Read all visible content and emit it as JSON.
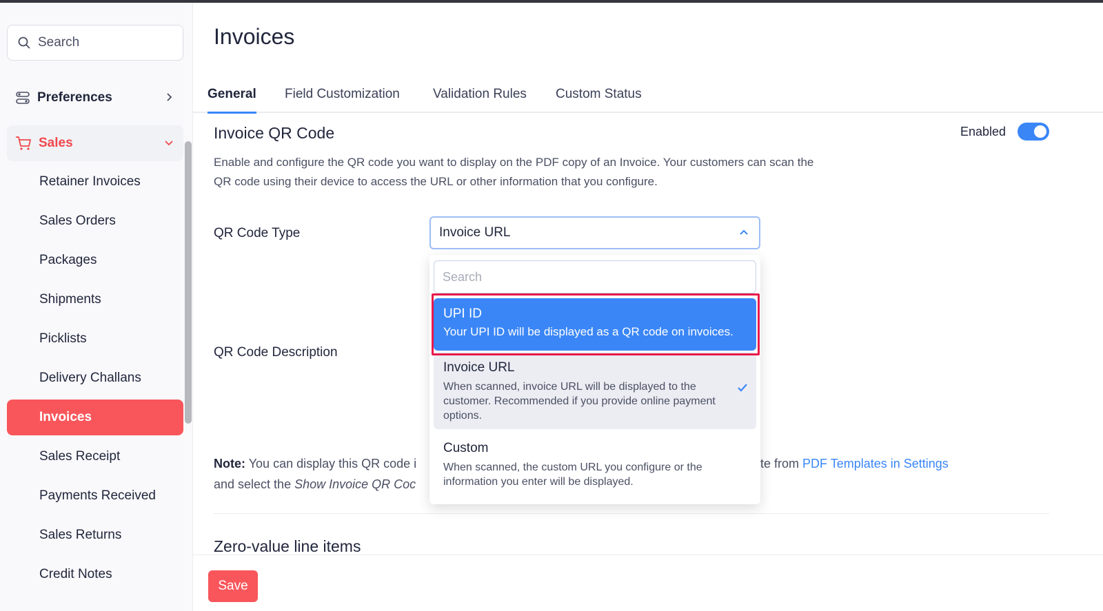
{
  "sidebar": {
    "search_placeholder": "Search",
    "groups": {
      "preferences": "Preferences",
      "sales": "Sales"
    },
    "items": [
      {
        "label": "Retainer Invoices"
      },
      {
        "label": "Sales Orders"
      },
      {
        "label": "Packages"
      },
      {
        "label": "Shipments"
      },
      {
        "label": "Picklists"
      },
      {
        "label": "Delivery Challans"
      },
      {
        "label": "Invoices",
        "active": true
      },
      {
        "label": "Sales Receipt"
      },
      {
        "label": "Payments Received"
      },
      {
        "label": "Sales Returns"
      },
      {
        "label": "Credit Notes"
      }
    ]
  },
  "page": {
    "title": "Invoices",
    "tabs": [
      {
        "label": "General",
        "active": true
      },
      {
        "label": "Field Customization"
      },
      {
        "label": "Validation Rules"
      },
      {
        "label": "Custom Status"
      }
    ]
  },
  "qr_section": {
    "title": "Invoice QR Code",
    "enabled_label": "Enabled",
    "enabled": true,
    "description": "Enable and configure the QR code you want to display on the PDF copy of an Invoice. Your customers can scan the QR code using their device to access the URL or other information that you configure.",
    "qr_type_label": "QR Code Type",
    "qr_type_value": "Invoice URL",
    "qr_desc_label": "QR Code Description",
    "note_label": "Note:",
    "note_text_1": "You can display this QR code i",
    "note_text_2": "and select the",
    "note_italic": "Show Invoice QR Coc",
    "note_right_text": "te from",
    "note_link": "PDF Templates in Settings"
  },
  "dropdown": {
    "search_placeholder": "Search",
    "options": [
      {
        "title": "UPI ID",
        "desc": "Your UPI ID will be displayed as a QR code on invoices.",
        "highlighted": true
      },
      {
        "title": "Invoice URL",
        "desc": "When scanned, invoice URL will be displayed to the customer. Recommended if you provide online payment options.",
        "selected": true
      },
      {
        "title": "Custom",
        "desc": "When scanned, the custom URL you configure or the information you enter will be displayed."
      }
    ]
  },
  "zero_section": {
    "title": "Zero-value line items"
  },
  "footer": {
    "save_label": "Save"
  },
  "colors": {
    "accent": "#3a86f7",
    "brand_red": "#f8565b",
    "highlight_border": "#e8194a"
  }
}
